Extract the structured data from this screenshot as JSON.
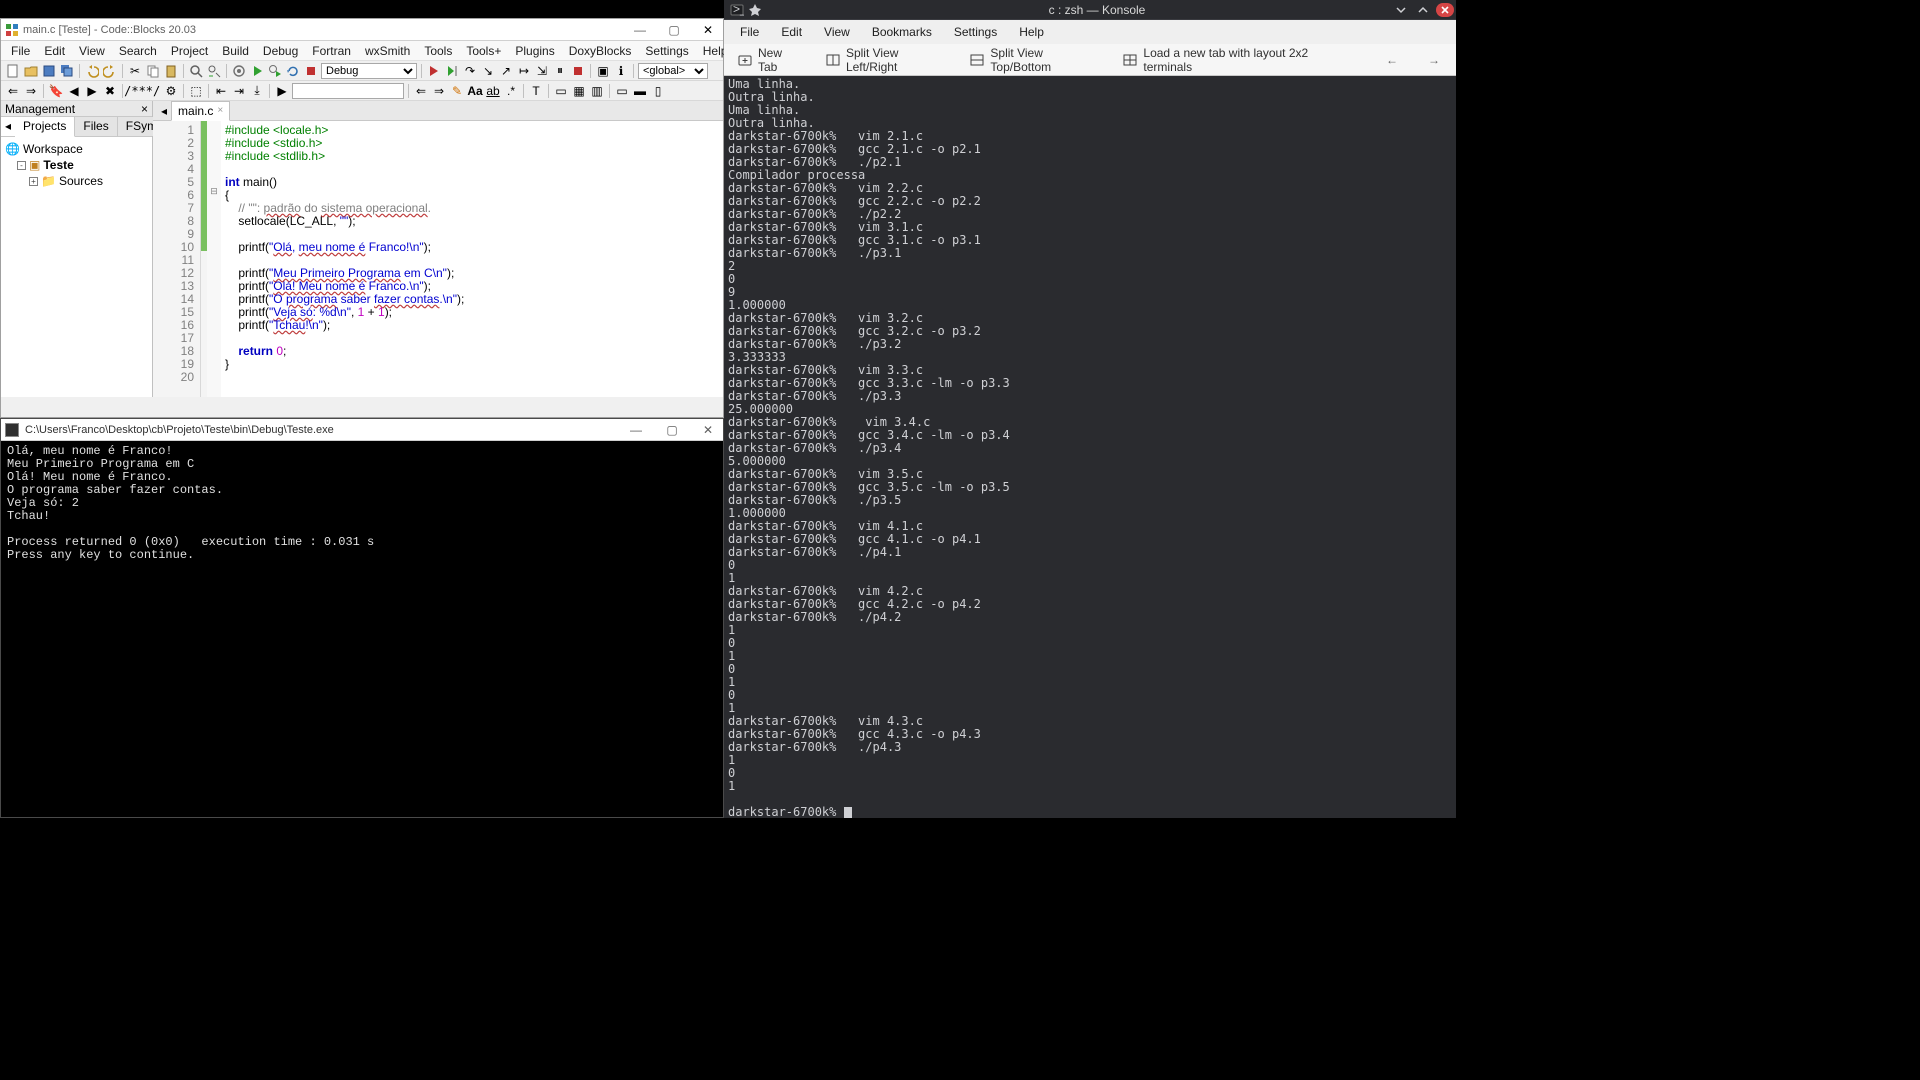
{
  "codeblocks": {
    "title": "main.c [Teste] - Code::Blocks 20.03",
    "window_icon": "codeblocks-icon",
    "win_btns": {
      "min": "—",
      "max": "▢",
      "close": "✕"
    },
    "menu": [
      "File",
      "Edit",
      "View",
      "Search",
      "Project",
      "Build",
      "Debug",
      "Fortran",
      "wxSmith",
      "Tools",
      "Tools+",
      "Plugins",
      "DoxyBlocks",
      "Settings",
      "Help"
    ],
    "toolbar_row1": {
      "config_select": "Debug",
      "scope_select": "<global>"
    },
    "toolbar_row2": {
      "search_value": "",
      "search_placeholder": ""
    },
    "management": {
      "header": "Management",
      "tabs": [
        "Projects",
        "Files",
        "FSymbols"
      ],
      "active_tab": 0,
      "tree": {
        "root": "Workspace",
        "project": "Teste",
        "folder": "Sources"
      }
    },
    "editor_tab": "main.c",
    "line_count": 20,
    "changed_lines": [
      1,
      2,
      3,
      4,
      5,
      6,
      7,
      8,
      9,
      10
    ],
    "fold_line": 6,
    "code": [
      {
        "type": "pre",
        "parts": [
          {
            "c": "kw-pre",
            "t": "#include <locale.h>"
          }
        ]
      },
      {
        "type": "pre",
        "parts": [
          {
            "c": "kw-pre",
            "t": "#include <stdio.h>"
          }
        ]
      },
      {
        "type": "pre",
        "parts": [
          {
            "c": "kw-pre",
            "t": "#include <stdlib.h>"
          }
        ]
      },
      {
        "type": "blank",
        "parts": []
      },
      {
        "type": "sig",
        "parts": [
          {
            "c": "kw",
            "t": "int"
          },
          {
            "c": "",
            "t": " "
          },
          {
            "c": "fn",
            "t": "main"
          },
          {
            "c": "",
            "t": "()"
          }
        ]
      },
      {
        "type": "brace",
        "parts": [
          {
            "c": "",
            "t": "{"
          }
        ]
      },
      {
        "type": "com",
        "indent": 2,
        "parts": [
          {
            "c": "com",
            "t": "// \"\": "
          },
          {
            "c": "com-under",
            "t": "padrão"
          },
          {
            "c": "com",
            "t": " do "
          },
          {
            "c": "com-under",
            "t": "sistema operacional"
          },
          {
            "c": "com",
            "t": "."
          }
        ]
      },
      {
        "type": "stmt",
        "indent": 2,
        "parts": [
          {
            "c": "fn",
            "t": "setlocale"
          },
          {
            "c": "",
            "t": "(LC_ALL, "
          },
          {
            "c": "str",
            "t": "\"\""
          },
          {
            "c": "",
            "t": ");"
          }
        ]
      },
      {
        "type": "blank",
        "parts": []
      },
      {
        "type": "stmt",
        "indent": 2,
        "parts": [
          {
            "c": "fn",
            "t": "printf"
          },
          {
            "c": "",
            "t": "("
          },
          {
            "c": "str",
            "t": "\""
          },
          {
            "c": "str-under",
            "t": "Olá"
          },
          {
            "c": "str",
            "t": ", "
          },
          {
            "c": "str-under",
            "t": "meu nome é"
          },
          {
            "c": "str",
            "t": " Franco!\\n\""
          },
          {
            "c": "",
            "t": ");"
          }
        ]
      },
      {
        "type": "blank",
        "parts": []
      },
      {
        "type": "stmt",
        "indent": 2,
        "parts": [
          {
            "c": "fn",
            "t": "printf"
          },
          {
            "c": "",
            "t": "("
          },
          {
            "c": "str",
            "t": "\""
          },
          {
            "c": "str-under",
            "t": "Meu Primeiro Programa"
          },
          {
            "c": "str",
            "t": " em C\\n\""
          },
          {
            "c": "",
            "t": ");"
          }
        ]
      },
      {
        "type": "stmt",
        "indent": 2,
        "parts": [
          {
            "c": "fn",
            "t": "printf"
          },
          {
            "c": "",
            "t": "("
          },
          {
            "c": "str",
            "t": "\""
          },
          {
            "c": "str-under",
            "t": "Olá! Meu nome é"
          },
          {
            "c": "str",
            "t": " Franco.\\n\""
          },
          {
            "c": "",
            "t": ");"
          }
        ]
      },
      {
        "type": "stmt",
        "indent": 2,
        "parts": [
          {
            "c": "fn",
            "t": "printf"
          },
          {
            "c": "",
            "t": "("
          },
          {
            "c": "str",
            "t": "\"O "
          },
          {
            "c": "str-under",
            "t": "programa"
          },
          {
            "c": "str",
            "t": " saber "
          },
          {
            "c": "str-under",
            "t": "fazer contas"
          },
          {
            "c": "str",
            "t": ".\\n\""
          },
          {
            "c": "",
            "t": ");"
          }
        ]
      },
      {
        "type": "stmt",
        "indent": 2,
        "parts": [
          {
            "c": "fn",
            "t": "printf"
          },
          {
            "c": "",
            "t": "("
          },
          {
            "c": "str",
            "t": "\""
          },
          {
            "c": "str-under",
            "t": "Veja só"
          },
          {
            "c": "str",
            "t": ": %d\\n\""
          },
          {
            "c": "",
            "t": ", "
          },
          {
            "c": "num",
            "t": "1"
          },
          {
            "c": "",
            "t": " + "
          },
          {
            "c": "num",
            "t": "1"
          },
          {
            "c": "",
            "t": ");"
          }
        ]
      },
      {
        "type": "stmt",
        "indent": 2,
        "parts": [
          {
            "c": "fn",
            "t": "printf"
          },
          {
            "c": "",
            "t": "("
          },
          {
            "c": "str",
            "t": "\""
          },
          {
            "c": "str-under",
            "t": "Tchau"
          },
          {
            "c": "str",
            "t": "!\\n\""
          },
          {
            "c": "",
            "t": ");"
          }
        ]
      },
      {
        "type": "blank",
        "parts": []
      },
      {
        "type": "stmt",
        "indent": 2,
        "parts": [
          {
            "c": "kw",
            "t": "return"
          },
          {
            "c": "",
            "t": " "
          },
          {
            "c": "num",
            "t": "0"
          },
          {
            "c": "",
            "t": ";"
          }
        ]
      },
      {
        "type": "brace",
        "parts": [
          {
            "c": "",
            "t": "}"
          }
        ]
      },
      {
        "type": "blank",
        "parts": []
      }
    ]
  },
  "cmd": {
    "title": "C:\\Users\\Franco\\Desktop\\cb\\Projeto\\Teste\\bin\\Debug\\Teste.exe",
    "win_btns": {
      "min": "—",
      "max": "▢",
      "close": "✕"
    },
    "lines": [
      "Olá, meu nome é Franco!",
      "Meu Primeiro Programa em C",
      "Olá! Meu nome é Franco.",
      "O programa saber fazer contas.",
      "Veja só: 2",
      "Tchau!",
      "",
      "Process returned 0 (0x0)   execution time : 0.031 s",
      "Press any key to continue."
    ]
  },
  "konsole": {
    "title": "c : zsh — Konsole",
    "win_btns": {
      "min": "⌄",
      "max": "⌃",
      "close": "✕"
    },
    "menu": [
      "File",
      "Edit",
      "View",
      "Bookmarks",
      "Settings",
      "Help"
    ],
    "toolbar": {
      "new_tab": "New Tab",
      "split_lr": "Split View Left/Right",
      "split_tb": "Split View Top/Bottom",
      "load_layout": "Load a new tab with layout 2x2 terminals"
    },
    "prompt": "darkstar-6700k%",
    "lines": [
      "Uma linha.",
      "Outra linha.",
      "Uma linha.",
      "Outra linha.",
      "darkstar-6700k%   vim 2.1.c",
      "darkstar-6700k%   gcc 2.1.c -o p2.1",
      "darkstar-6700k%   ./p2.1",
      "Compilador processa",
      "darkstar-6700k%   vim 2.2.c",
      "darkstar-6700k%   gcc 2.2.c -o p2.2",
      "darkstar-6700k%   ./p2.2",
      "darkstar-6700k%   vim 3.1.c",
      "darkstar-6700k%   gcc 3.1.c -o p3.1",
      "darkstar-6700k%   ./p3.1",
      "2",
      "0",
      "9",
      "1.000000",
      "darkstar-6700k%   vim 3.2.c",
      "darkstar-6700k%   gcc 3.2.c -o p3.2",
      "darkstar-6700k%   ./p3.2",
      "3.333333",
      "darkstar-6700k%   vim 3.3.c",
      "darkstar-6700k%   gcc 3.3.c -lm -o p3.3",
      "darkstar-6700k%   ./p3.3",
      "25.000000",
      "darkstar-6700k%    vim 3.4.c",
      "darkstar-6700k%   gcc 3.4.c -lm -o p3.4",
      "darkstar-6700k%   ./p3.4",
      "5.000000",
      "darkstar-6700k%   vim 3.5.c",
      "darkstar-6700k%   gcc 3.5.c -lm -o p3.5",
      "darkstar-6700k%   ./p3.5",
      "1.000000",
      "darkstar-6700k%   vim 4.1.c",
      "darkstar-6700k%   gcc 4.1.c -o p4.1",
      "darkstar-6700k%   ./p4.1",
      "0",
      "1",
      "darkstar-6700k%   vim 4.2.c",
      "darkstar-6700k%   gcc 4.2.c -o p4.2",
      "darkstar-6700k%   ./p4.2",
      "1",
      "0",
      "1",
      "0",
      "1",
      "0",
      "1",
      "darkstar-6700k%   vim 4.3.c",
      "darkstar-6700k%   gcc 4.3.c -o p4.3",
      "darkstar-6700k%   ./p4.3",
      "1",
      "0",
      "1",
      "",
      "darkstar-6700k% "
    ]
  }
}
